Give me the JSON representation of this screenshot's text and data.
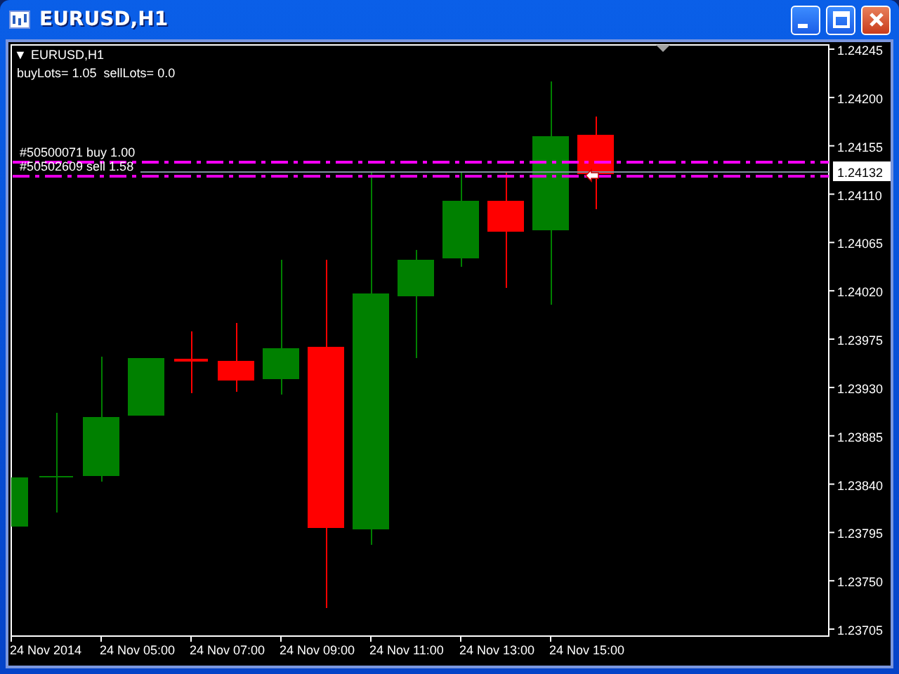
{
  "window": {
    "title": "EURUSD,H1"
  },
  "chart": {
    "menu_arrow": "▼",
    "symbol": "EURUSD,H1",
    "info": "buyLots= 1.05  sellLots= 0.0",
    "orders": [
      {
        "label": "#50500071 buy 1.00",
        "kind": "buy"
      },
      {
        "label": "#50502609 sell 1.58",
        "kind": "sell"
      }
    ],
    "current_price": "1.24132",
    "price_labels": [
      "1.24245",
      "1.24200",
      "1.24155",
      "1.24110",
      "1.24065",
      "1.24020",
      "1.23975",
      "1.23930",
      "1.23885",
      "1.23840",
      "1.23795",
      "1.23750",
      "1.23705"
    ],
    "time_labels": [
      "24 Nov 2014",
      "24 Nov 05:00",
      "24 Nov 07:00",
      "24 Nov 09:00",
      "24 Nov 11:00",
      "24 Nov 13:00",
      "24 Nov 15:00"
    ]
  }
}
